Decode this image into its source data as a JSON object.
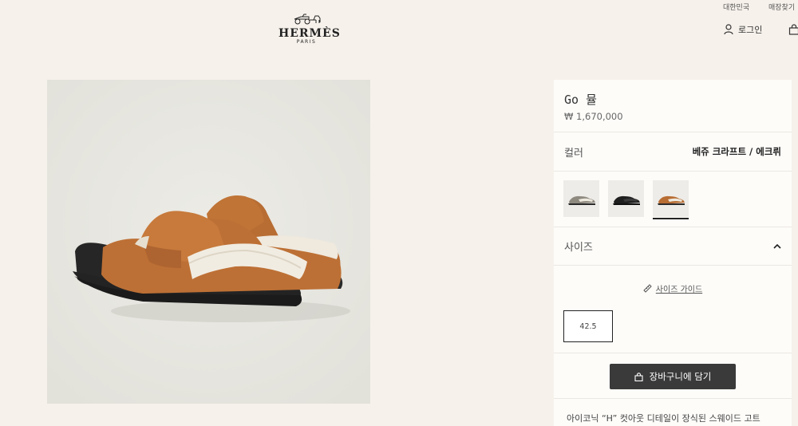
{
  "header": {
    "utility_links": [
      "대한민국",
      "매장찾기"
    ],
    "logo": {
      "wordmark": "HERMÈS",
      "city": "PARIS"
    },
    "login_label": "로그인"
  },
  "product": {
    "name": "Go 뮬",
    "price": "₩ 1,670,000",
    "color_label": "컬러",
    "color_value": "베쥬 크라프트 / 에크뤼",
    "size_label": "사이즈",
    "size_guide_label": "사이즈 가이드",
    "sizes": [
      "42.5"
    ],
    "add_to_cart_label": "장바구니에 담기",
    "description": "아이코닉 “H” 컷아웃 디테일이 장식된 스웨이드 고트"
  },
  "colors": {
    "background": "#f6f1eb",
    "panel": "#fdfcf9",
    "button": "#3a3a3a"
  }
}
